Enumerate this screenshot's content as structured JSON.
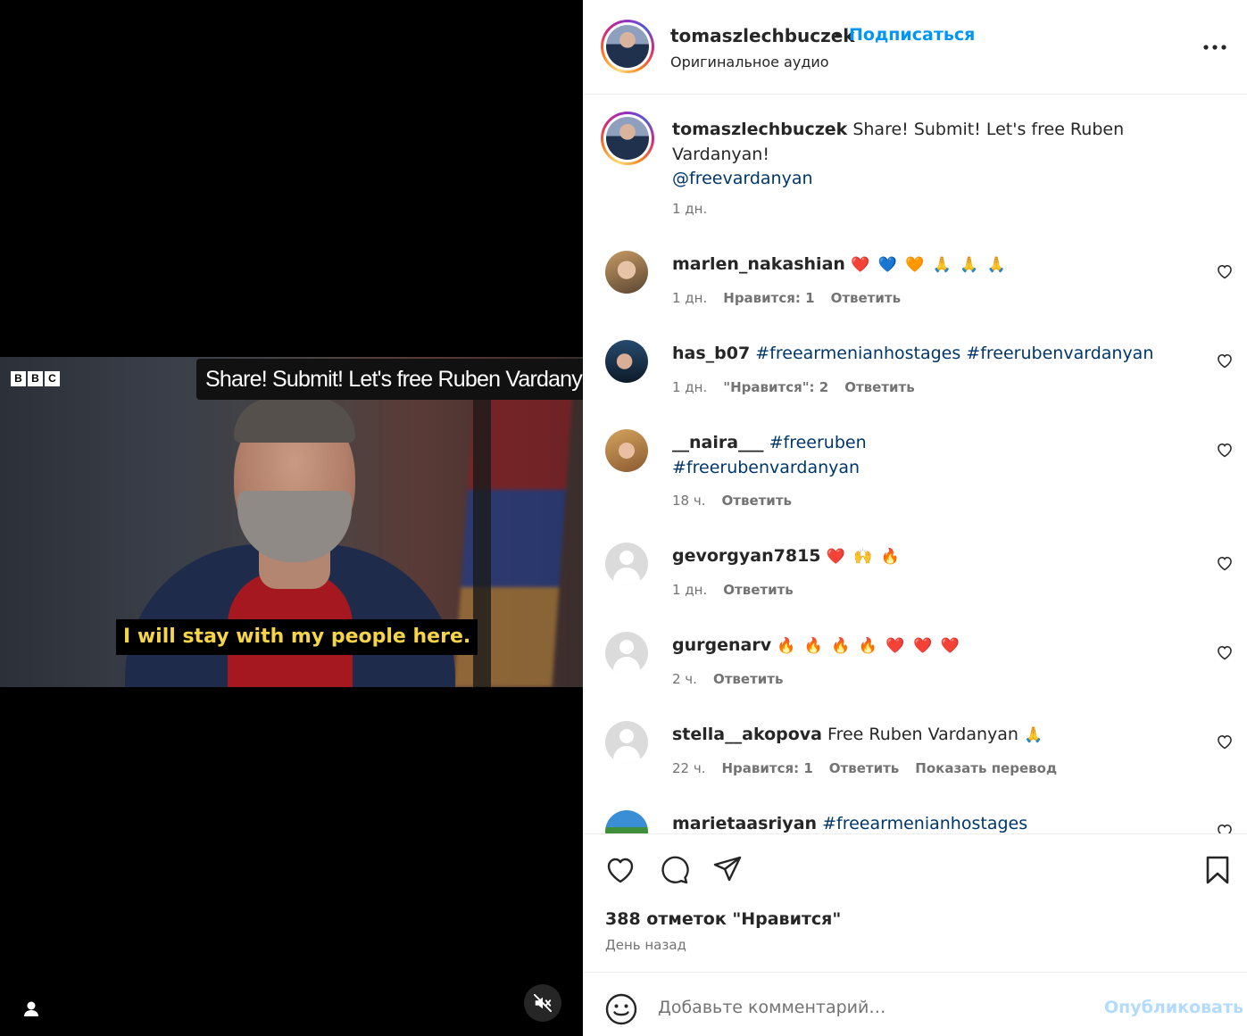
{
  "video": {
    "logo": [
      "B",
      "B",
      "C"
    ],
    "top_caption": "Share! Submit! Let's free Ruben Vardanyan!",
    "subtitle": "I will stay with my people here."
  },
  "header": {
    "username": "tomaszlechbuczek",
    "dot": "•",
    "follow_label": "Подписаться",
    "audio": "Оригинальное аудио"
  },
  "caption": {
    "username": "tomaszlechbuczek",
    "text": "Share! Submit! Let's free Ruben Vardanyan!",
    "mention": "@freevardanyan",
    "time": "1 дн."
  },
  "comments": [
    {
      "username": "marlen_nakashian",
      "text": "",
      "emoji": "❤️ 💙 🧡 🙏 🙏 🙏",
      "time": "1 дн.",
      "likes": "Нравится: 1",
      "reply": "Ответить",
      "translate": ""
    },
    {
      "username": "has_b07",
      "text": "#freearmenianhostages #freerubenvardanyan",
      "emoji": "",
      "time": "1 дн.",
      "likes": "\"Нравится\": 2",
      "reply": "Ответить",
      "translate": ""
    },
    {
      "username": "__naira___",
      "text": "#freeruben #freerubenvardanyan",
      "emoji": "",
      "time": "18 ч.",
      "likes": "",
      "reply": "Ответить",
      "translate": ""
    },
    {
      "username": "gevorgyan7815",
      "text": "",
      "emoji": "❤️ 🙌 🔥",
      "time": "1 дн.",
      "likes": "",
      "reply": "Ответить",
      "translate": ""
    },
    {
      "username": "gurgenarv",
      "text": "",
      "emoji": "🔥 🔥 🔥 🔥 ❤️ ❤️ ❤️",
      "time": "2 ч.",
      "likes": "",
      "reply": "Ответить",
      "translate": ""
    },
    {
      "username": "stella__akopova",
      "text": "Free Ruben Vardanyan",
      "emoji": "🙏",
      "time": "22 ч.",
      "likes": "Нравится: 1",
      "reply": "Ответить",
      "translate": "Показать перевод"
    },
    {
      "username": "marietaasriyan",
      "text": "#freearmenianhostages",
      "emoji": "",
      "time": "",
      "likes": "",
      "reply": "",
      "translate": ""
    }
  ],
  "actions": {
    "likes": "388 отметок \"Нравится\"",
    "time": "День назад"
  },
  "add_comment": {
    "placeholder": "Добавьте комментарий…",
    "publish": "Опубликовать"
  }
}
